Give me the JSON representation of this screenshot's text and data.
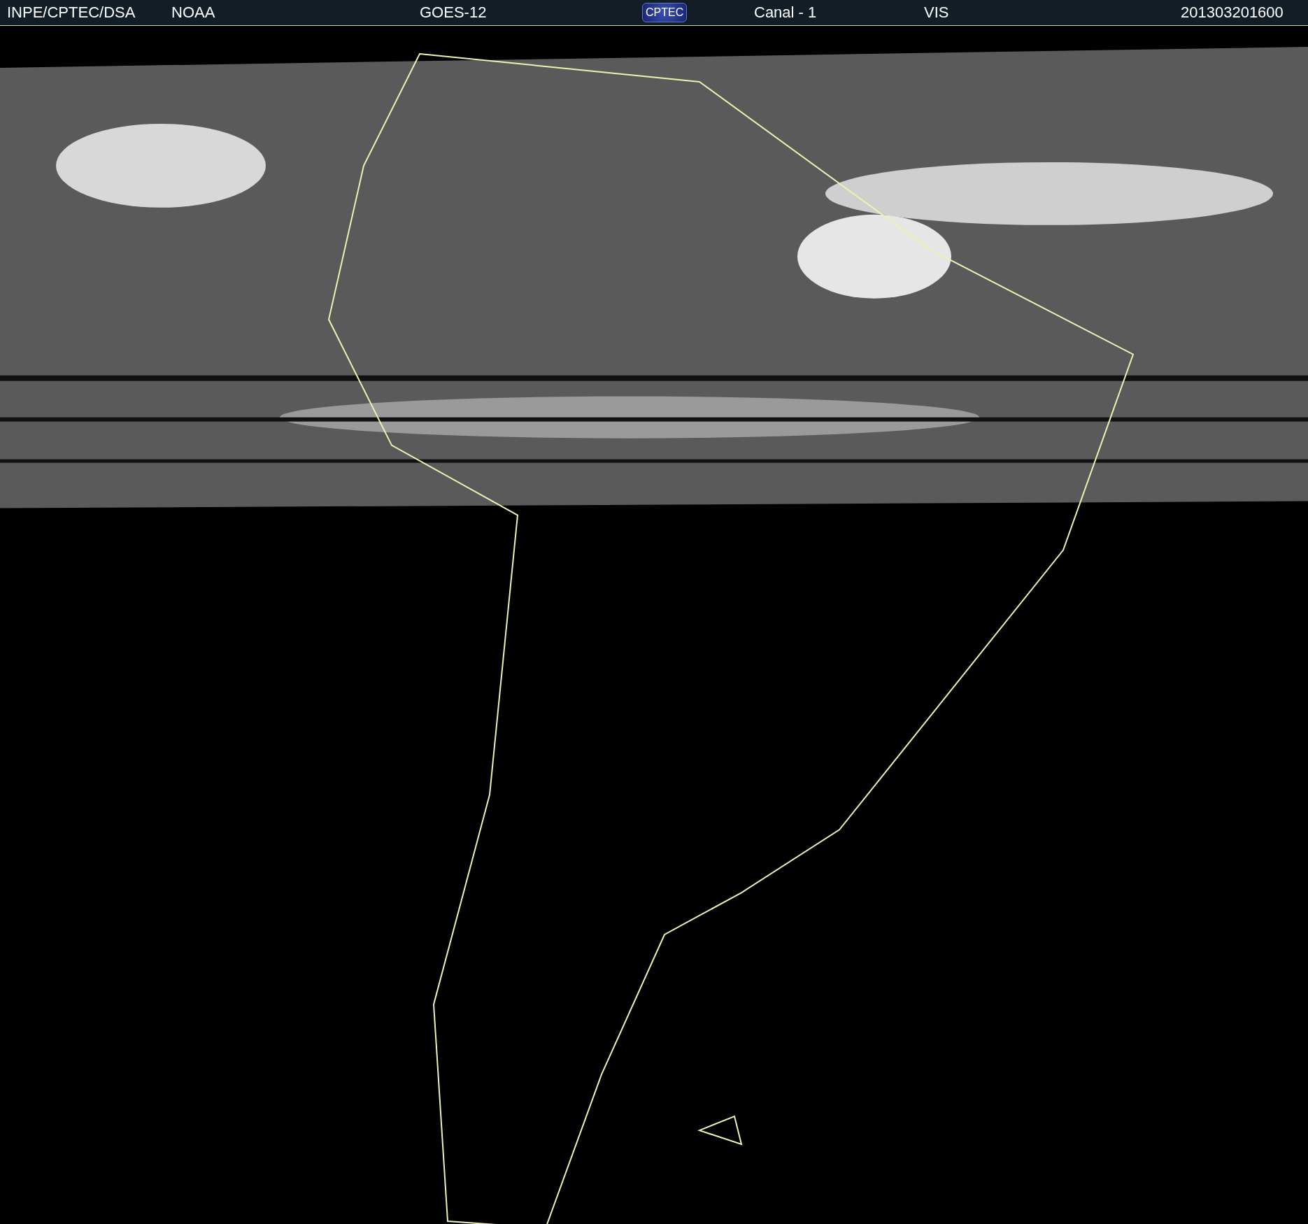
{
  "header": {
    "items": [
      {
        "kind": "text",
        "text": "INPE/CPTEC/DSA"
      },
      {
        "kind": "text",
        "text": "NOAA"
      },
      {
        "kind": "text",
        "text": "GOES-12"
      },
      {
        "kind": "logo",
        "text": "CPTEC"
      },
      {
        "kind": "text",
        "text": "Canal - 1"
      },
      {
        "kind": "text",
        "text": "VIS"
      },
      {
        "kind": "text",
        "text": "201303201600"
      }
    ]
  }
}
